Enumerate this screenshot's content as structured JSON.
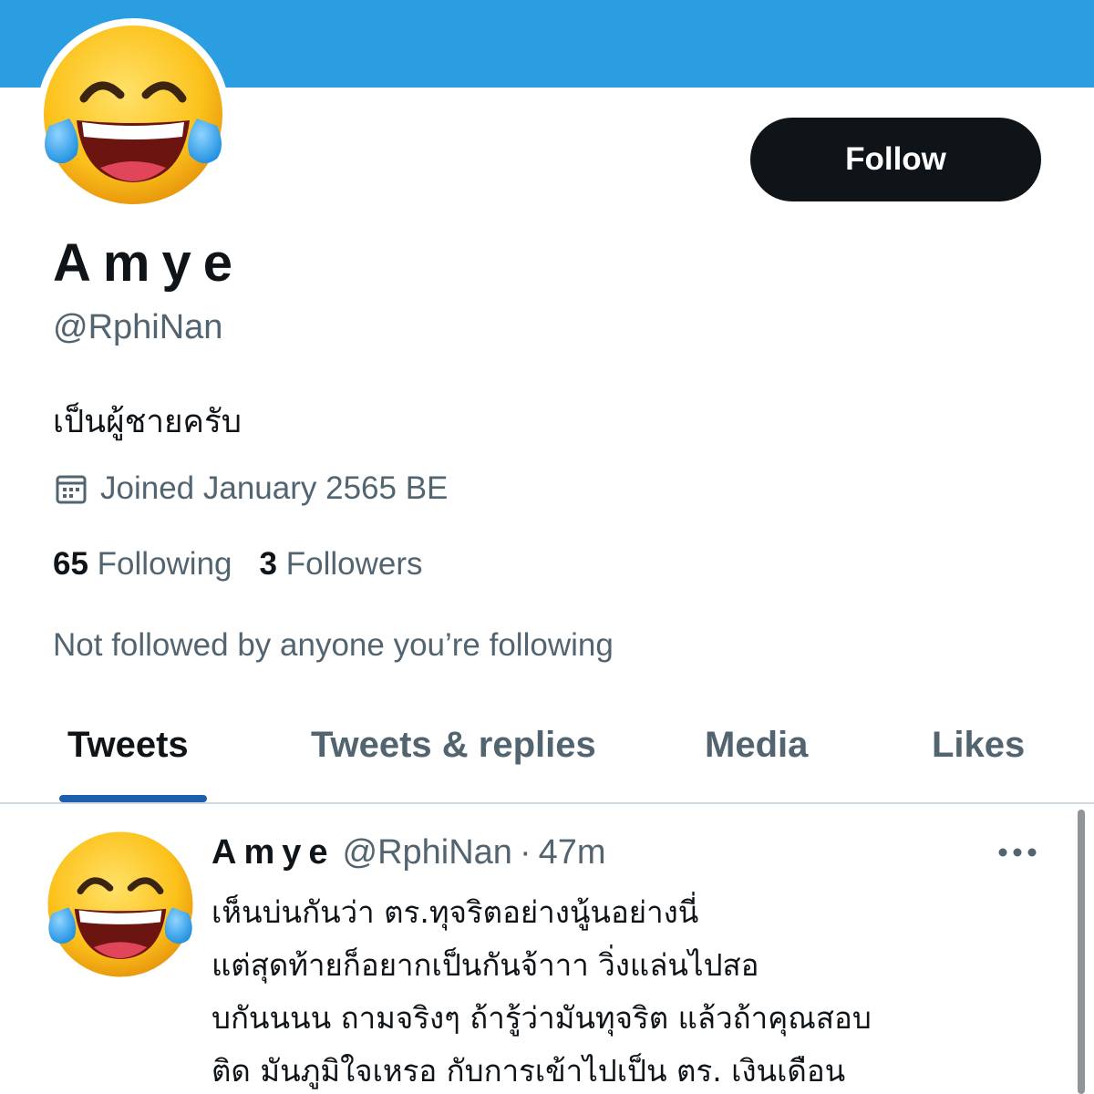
{
  "colors": {
    "banner": "#2a9ee0",
    "follow_button_bg": "#0f1419",
    "tab_indicator": "#1d5fae",
    "secondary_text": "#536471"
  },
  "profile": {
    "avatar_icon": "face-with-tears-of-joy-emoji",
    "follow_label": "Follow",
    "display_name": "Amye",
    "handle": "@RphiNan",
    "bio": "เป็นผู้ชายครับ",
    "joined_icon": "calendar-icon",
    "joined": "Joined January 2565 BE",
    "following_count": "65",
    "following_label": "Following",
    "followers_count": "3",
    "followers_label": "Followers",
    "not_followed": "Not followed by anyone you’re following"
  },
  "tabs": [
    {
      "label": "Tweets",
      "active": true
    },
    {
      "label": "Tweets & replies",
      "active": false
    },
    {
      "label": "Media",
      "active": false
    },
    {
      "label": "Likes",
      "active": false
    }
  ],
  "tweet": {
    "avatar_icon": "face-with-tears-of-joy-emoji",
    "name": "Amye",
    "handle": "@RphiNan",
    "separator": "·",
    "time": "47m",
    "more_icon": "more-horizontal-icon",
    "lines": [
      "เห็นบ่นกันว่า ตร.ทุจริตอย่างนู้นอย่างนี่",
      " แต่สุดท้ายก็อยากเป็นกันจ้าาา วิ่งแล่นไปสอ",
      "บกันนนน ถามจริงๆ ถ้ารู้ว่ามันทุจริต แล้วถ้าคุณสอบ",
      "ติด มันภูมิใจเหรอ กับการเข้าไปเป็น ตร. เงินเดือน"
    ]
  }
}
